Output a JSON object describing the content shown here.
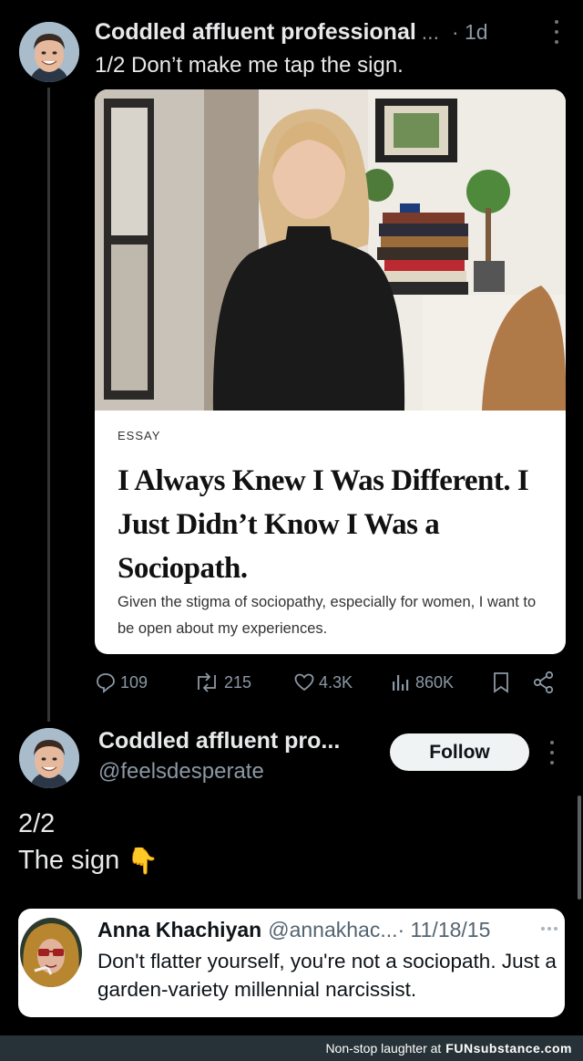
{
  "tweet1": {
    "name": "Coddled affluent professional",
    "name_truncation": "...",
    "time": "· 1d",
    "text": "1/2 Don’t make me tap the sign.",
    "card": {
      "kicker": "ESSAY",
      "headline": "I Always Knew I Was Different. I Just Didn’t Know I Was a Sociopath.",
      "subhead": "Given the stigma of sociopathy, especially for women, I want to be open about my experiences."
    },
    "actions": {
      "replies": "109",
      "reposts": "215",
      "likes": "4.3K",
      "views": "860K"
    }
  },
  "tweet2": {
    "name": "Coddled affluent pro...",
    "handle": "@feelsdesperate",
    "follow_label": "Follow",
    "line1": "2/2",
    "line2": "The sign",
    "emoji": "👇"
  },
  "quote": {
    "name": "Anna Khachiyan",
    "handle": "@annakhac...",
    "date": "· 11/18/15",
    "text": "Don't flatter yourself, you're not a sociopath. Just a garden-variety millennial narcissist."
  },
  "watermark": {
    "text": "Non-stop laughter at",
    "brand": "FUNsubstance.com"
  },
  "colors": {
    "background": "#000000",
    "text_primary": "#e7e9ea",
    "text_secondary": "#8b98a5",
    "watermark_bar": "#273238"
  }
}
